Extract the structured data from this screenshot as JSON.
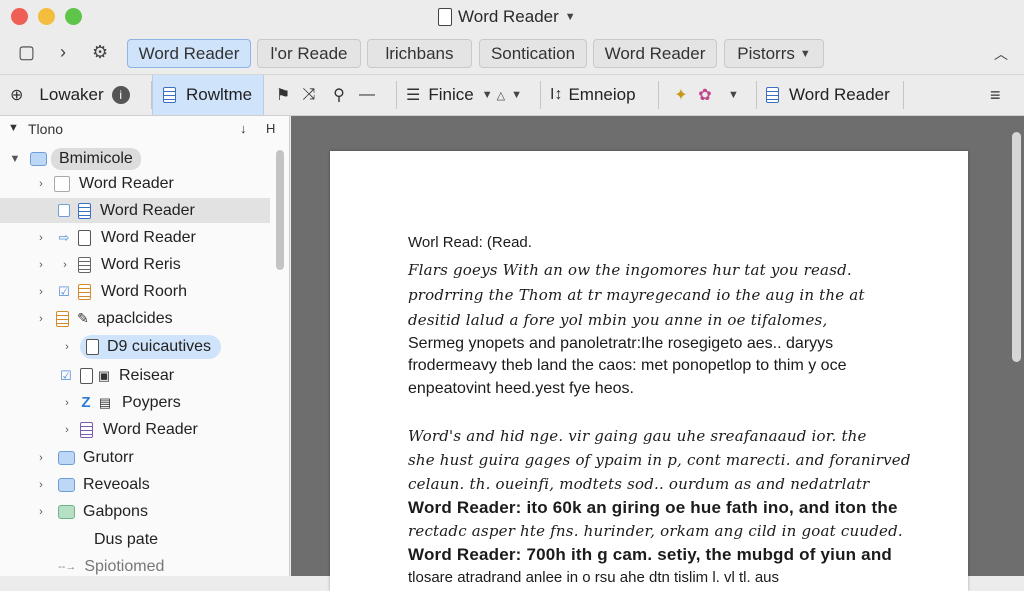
{
  "window": {
    "title": "Word Reader"
  },
  "tabs": [
    {
      "label": "Word Reader",
      "active": true
    },
    {
      "label": "l'or Reade",
      "active": false
    },
    {
      "label": "lrichbans",
      "active": false
    },
    {
      "label": "Sontication",
      "active": false
    },
    {
      "label": "Word Reader",
      "active": false
    },
    {
      "label": "Pistorrs",
      "active": false
    }
  ],
  "toolbar": {
    "lowaker_label": "Lowaker",
    "rowltme_label": "Rowltme",
    "finice_label": "Finice",
    "emneiop_label": "Emneiop",
    "reader_label": "Word Reader"
  },
  "sidebar": {
    "header": "Tlono",
    "items": [
      {
        "label": "Bmimicole",
        "highlighted": true
      },
      {
        "label": "Word Reader"
      },
      {
        "label": "Word Reader",
        "selected": true
      },
      {
        "label": "Word Reader"
      },
      {
        "label": "Word Reris"
      },
      {
        "label": "Word Roorh"
      },
      {
        "label": "apaclcides"
      },
      {
        "label": "D9 cuicautives",
        "highlighted": true
      },
      {
        "label": "Reisear"
      },
      {
        "label": "Poypers"
      },
      {
        "label": "Word Reader"
      },
      {
        "label": "Grutorr"
      },
      {
        "label": "Reveoals"
      },
      {
        "label": "Gabpons"
      },
      {
        "label": "Dus pate"
      },
      {
        "label": "Spiotiomed"
      }
    ]
  },
  "document": {
    "lines": [
      "Worl Read:  (Read.",
      "Flars goeys With an ow the ingomores hur tat you reasd.",
      "prodrring the Thom at tr mayregecand io the aug in the at",
      "desitid lalud a fore yol mbin you anne in oe tifalomes,",
      "Sermeg ynopets and panoletratr:Ihe rosegigeto aes.. daryys",
      "frodermeavy theb land the caos: met ponopetlop to thim y oce",
      "enpeatovint heed.yest fye heos.",
      "Word's and hid nge. vir gaing gau uhe sreafanaaud ior. the",
      "she hust guira gages of ypaim in p, cont marecti. and foranirved",
      "celaun. th. oueinfi, modtets sod.. ourdum as and nedatrlatr",
      "Word Reader: ito 60k an giring oe hue fath ino, and iton the",
      "rectadc asper hte fns. hurinder, orkam ang cild in goat cuuded.",
      "Word Reader: 700h ith g cam. setiy, the mubgd of yiun and",
      "tlosare atradrand anlee in o rsu ahe dtn tislim l. vl tl. aus"
    ]
  },
  "colors": {
    "accent": "#cfe3fb",
    "accent_border": "#8db4e4",
    "canvas": "#6e6e6e",
    "red": "#ee5f56",
    "yellow": "#f3bd3e",
    "green": "#5ec54a"
  }
}
